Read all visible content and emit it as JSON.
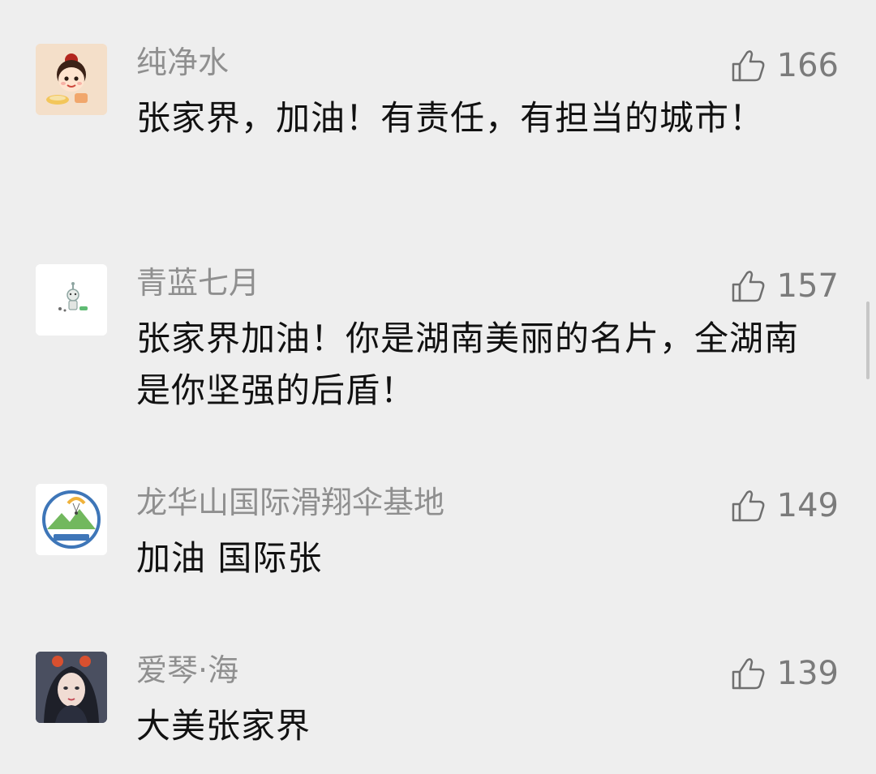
{
  "comments": [
    {
      "nickname": "纯净水",
      "likes": "166",
      "text": "张家界，加油！有责任，有担当的城市！",
      "avatar_icon": "cartoon-girl-avatar",
      "avatar_bg": "#f4dfc9"
    },
    {
      "nickname": "青蓝七月",
      "likes": "157",
      "text": "张家界加油！你是湖南美丽的名片，全湖南是你坚强的后盾！",
      "avatar_icon": "robot-avatar",
      "avatar_bg": "#ffffff"
    },
    {
      "nickname": "龙华山国际滑翔伞基地",
      "likes": "149",
      "text": "加油  国际张",
      "avatar_icon": "paragliding-logo-avatar",
      "avatar_bg": "#ffffff"
    },
    {
      "nickname": "爱琴·海",
      "likes": "139",
      "text": "大美张家界",
      "avatar_icon": "illustrated-woman-avatar",
      "avatar_bg": "#4a4f60"
    }
  ],
  "colors": {
    "background": "#eeeeee",
    "nickname": "#8f8f8f",
    "content": "#111111",
    "like": "#7b7b7b"
  }
}
